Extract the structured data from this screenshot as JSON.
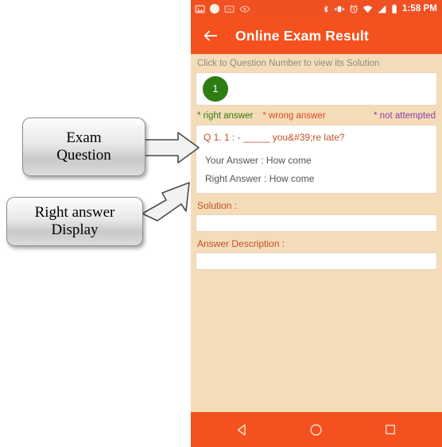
{
  "statusbar": {
    "left_icons": [
      "image-icon",
      "white-circle-icon",
      "news-icon",
      "eye-icon"
    ],
    "right_icons": [
      "bluetooth-icon",
      "vibrate-icon",
      "alarm-icon",
      "wifi-icon",
      "signal-icon",
      "battery-icon"
    ],
    "time": "1:58 PM"
  },
  "appbar": {
    "back_icon": "back-arrow-icon",
    "title": "Online Exam Result"
  },
  "main": {
    "hint": "Click to Question Number to view its Solution",
    "question_numbers": [
      {
        "label": "1",
        "state": "right"
      }
    ],
    "legend": [
      {
        "label": "* right answer",
        "color": "#2e7d13"
      },
      {
        "label": "* wrong answer",
        "color": "#e04a1f"
      },
      {
        "label": "* not attempted",
        "color": "#8b3fa8"
      }
    ],
    "question_text": "Q 1. 1 : - _____ you&#39;re late?",
    "your_answer": "Your Answer : How come",
    "right_answer": "Right Answer : How come",
    "solution_label": "Solution :",
    "solution_value": "",
    "solution_placeholder": "",
    "answer_description_label": "Answer Description :",
    "answer_description_value": "",
    "answer_description_placeholder": ""
  },
  "navbar": {
    "back_label": "back-triangle-icon",
    "home_label": "home-circle-icon",
    "recents_label": "recents-square-icon"
  },
  "callouts": {
    "exam_question_line1": "Exam",
    "exam_question_line2": "Question",
    "right_answer_line1": "Right answer",
    "right_answer_line2": "Display"
  },
  "colors": {
    "status_bar": "#f05123",
    "app_bar": "#f4511e",
    "page_background": "#f5dcb8",
    "badge_green": "#2e7d13",
    "question_text": "#c0522a"
  }
}
